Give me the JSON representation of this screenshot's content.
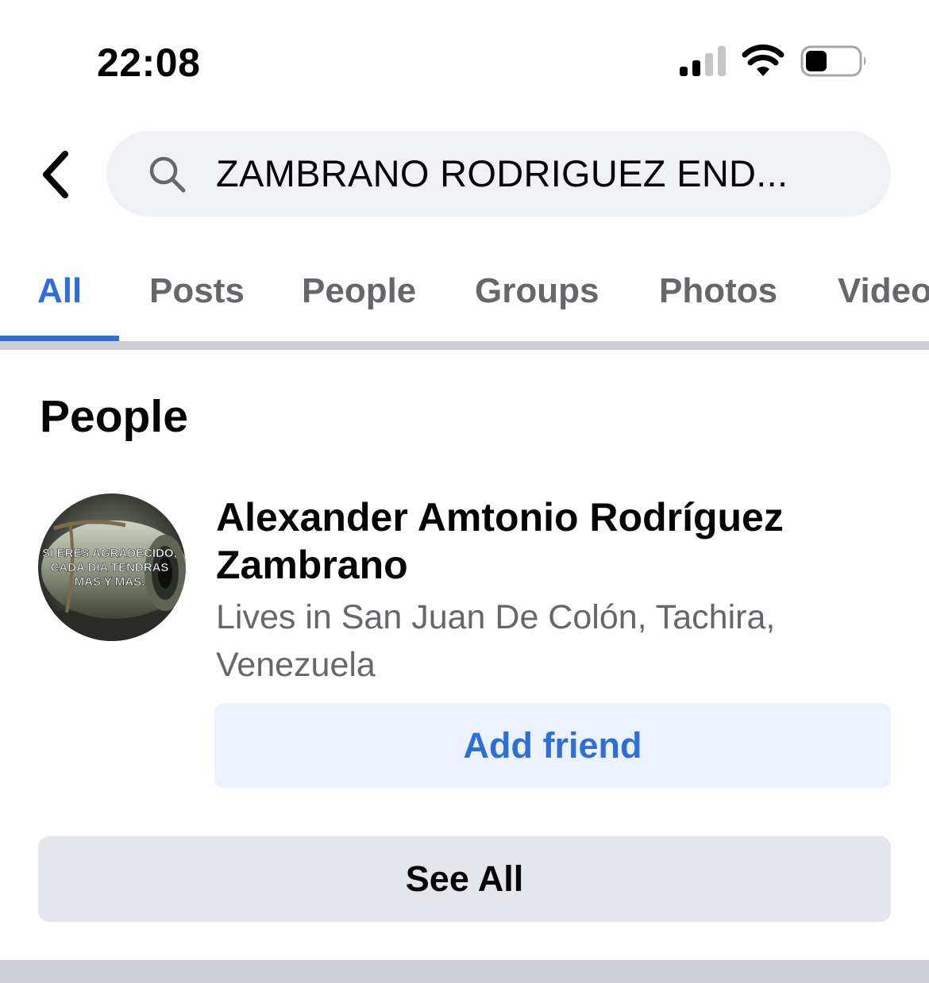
{
  "status_bar": {
    "time": "22:08",
    "icons": [
      "cellular-signal-icon",
      "wifi-icon",
      "battery-icon"
    ],
    "battery_level": 0.4
  },
  "header": {
    "back_icon": "chevron-left-icon",
    "search": {
      "icon": "search-icon",
      "value": "ZAMBRANO RODRIGUEZ END..."
    }
  },
  "tabs": [
    {
      "label": "All",
      "active": true
    },
    {
      "label": "Posts",
      "active": false
    },
    {
      "label": "People",
      "active": false
    },
    {
      "label": "Groups",
      "active": false
    },
    {
      "label": "Photos",
      "active": false
    },
    {
      "label": "Videos",
      "active": false
    }
  ],
  "people_section": {
    "title": "People",
    "results": [
      {
        "name": "Alexander Amtonio Rodríguez Zambrano",
        "location": "Lives in San Juan De Colón, Tachira, Venezuela",
        "avatar_text": [
          "SI ERES AGRADECIDO,",
          "CADA DIA TENDRAS",
          "MAS Y MAS."
        ],
        "action_label": "Add friend"
      }
    ],
    "see_all_label": "See All"
  },
  "colors": {
    "accent": "#2d6fd6",
    "secondary_text": "#65676b",
    "search_bg": "#eff1f5",
    "button_bg": "#e4e6eb",
    "add_friend_bg": "#ebf2fd"
  }
}
